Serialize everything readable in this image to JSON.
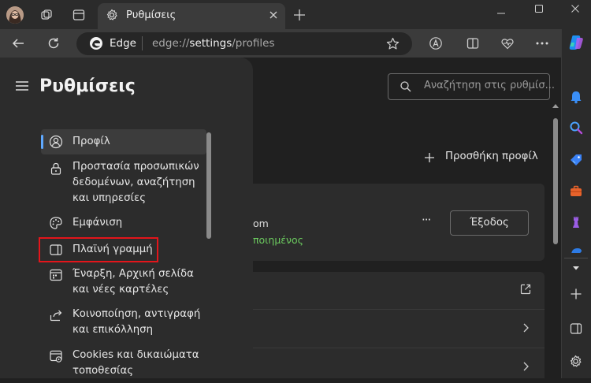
{
  "tab": {
    "title": "Ρυθμίσεις"
  },
  "address_bar": {
    "site_label": "Edge",
    "url_prefix": "edge://",
    "url_path": "settings",
    "url_suffix": "/profiles"
  },
  "settings": {
    "title": "Ρυθμίσεις",
    "search_placeholder": "Αναζήτηση στις ρυθμίσ...",
    "nav": [
      {
        "label": "Προφίλ"
      },
      {
        "line1": "Προστασία προσωπικών",
        "line2": "δεδομένων, αναζήτηση",
        "line3": "και υπηρεσίες"
      },
      {
        "label": "Εμφάνιση"
      },
      {
        "label": "Πλαϊνή γραμμή"
      },
      {
        "line1": "Έναρξη, Αρχική σελίδα",
        "line2": "και νέες καρτέλες"
      },
      {
        "line1": "Κοινοποίηση, αντιγραφή",
        "line2": "και επικόλληση"
      },
      {
        "line1": "Cookies και δικαιώματα",
        "line2": "τοποθεσίας"
      }
    ],
    "add_profile": "Προσθήκη προφίλ",
    "profile_email_fragment": "om",
    "profile_status_fragment": "ποιημένος",
    "signout_button": "Έξοδος",
    "more_dots": "···"
  }
}
